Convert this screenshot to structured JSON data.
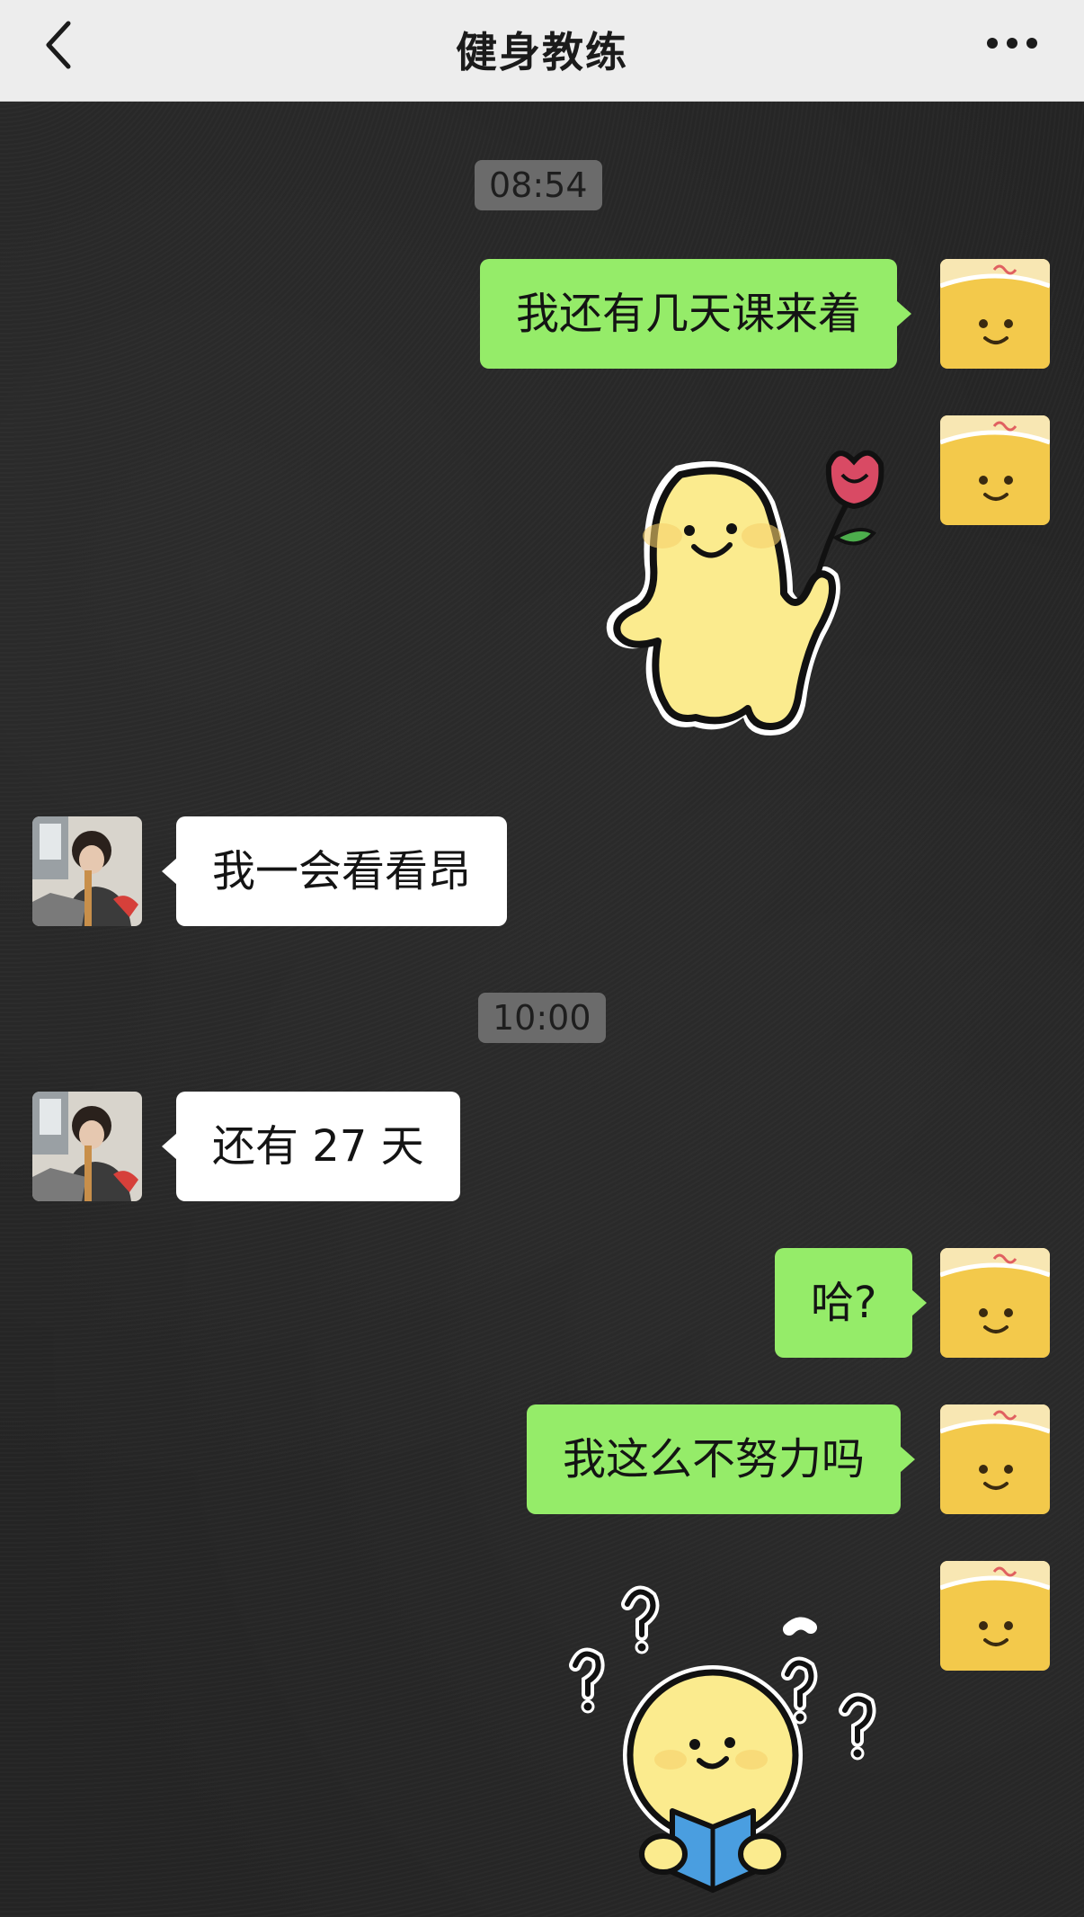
{
  "header": {
    "title": "健身教练",
    "back_icon": "chevron-left-icon",
    "more_icon": "ellipsis-icon"
  },
  "messages": {
    "time1": "08:54",
    "me1": "我还有几天课来着",
    "them1": "我一会看看昂",
    "time2": "10:00",
    "them2": "还有 27 天",
    "me2": "哈?",
    "me3": "我这么不努力吗"
  },
  "stickers": {
    "flower": "smiling-blob-holding-flower-sticker",
    "question": "reading-blob-question-marks-sticker"
  },
  "colors": {
    "outgoing_bubble": "#95ec69",
    "incoming_bubble": "#ffffff",
    "header_bg": "#ededed",
    "chat_bg": "#242424"
  }
}
